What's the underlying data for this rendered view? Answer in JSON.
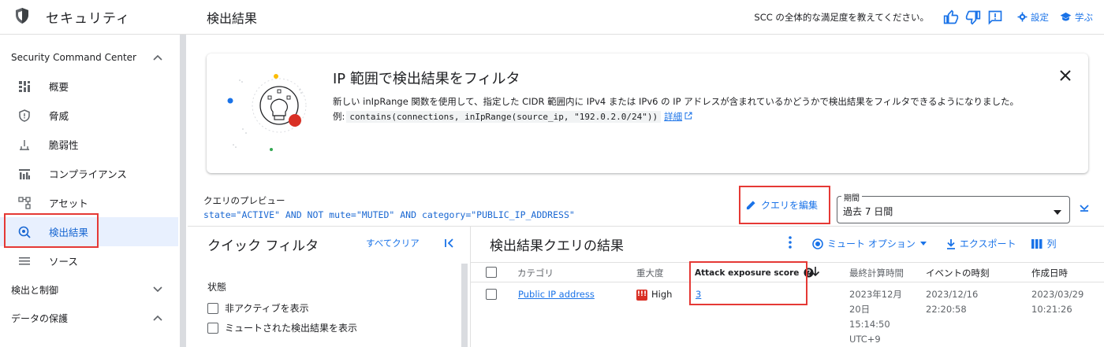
{
  "app": {
    "title": "セキュリティ"
  },
  "header": {
    "page_title": "検出結果",
    "survey_text": "SCC の全体的な満足度を教えてください。",
    "settings_label": "設定",
    "learn_label": "学ぶ"
  },
  "sidebar": {
    "section_scc": "Security Command Center",
    "items": [
      {
        "label": "概要",
        "icon": "dashboard-icon"
      },
      {
        "label": "脅威",
        "icon": "shield-icon"
      },
      {
        "label": "脆弱性",
        "icon": "vulnerability-icon"
      },
      {
        "label": "コンプライアンス",
        "icon": "compliance-icon"
      },
      {
        "label": "アセット",
        "icon": "asset-icon"
      },
      {
        "label": "検出結果",
        "icon": "findings-icon",
        "active": true
      },
      {
        "label": "ソース",
        "icon": "source-icon"
      }
    ],
    "section_detect": "検出と制御",
    "section_data": "データの保護"
  },
  "banner": {
    "title": "IP 範囲で検出結果をフィルタ",
    "description": "新しい inIpRange 関数を使用して、指定した CIDR 範囲内に IPv4 または IPv6 の IP アドレスが含まれているかどうかで検出結果をフィルタできるようになりました。",
    "example_prefix": "例:",
    "example_code": "contains(connections, inIpRange(source_ip, \"192.0.2.0/24\"))",
    "details_link": "詳細"
  },
  "query": {
    "preview_label": "クエリのプレビュー",
    "preview_text": "state=\"ACTIVE\" AND NOT mute=\"MUTED\" AND category=\"PUBLIC_IP_ADDRESS\"",
    "edit_label": "クエリを編集",
    "period_label": "期間",
    "period_value": "過去 7 日間"
  },
  "quick_filter": {
    "title": "クイック フィルタ",
    "clear_all": "すべてクリア",
    "status_label": "状態",
    "show_inactive": "非アクティブを表示",
    "show_muted": "ミュートされた検出結果を表示"
  },
  "results": {
    "title": "検出結果クエリの結果",
    "mute_options": "ミュート オプション",
    "export": "エクスポート",
    "columns_btn": "列",
    "columns": {
      "category": "カテゴリ",
      "severity": "重大度",
      "attack_score": "Attack exposure score",
      "last_scan": "最終計算時間",
      "event_time": "イベントの時刻",
      "created": "作成日時"
    },
    "rows": [
      {
        "category": "Public IP address",
        "severity": "High",
        "attack_score": "3",
        "last_scan_1": "2023年12月",
        "last_scan_2": "20日",
        "last_scan_3": "15:14:50",
        "last_scan_4": "UTC+9",
        "event_date": "2023/12/16",
        "event_time": "22:20:58",
        "created_date": "2023/03/29",
        "created_time": "10:21:26"
      }
    ]
  },
  "colors": {
    "accent": "#1a73e8",
    "highlight": "#e53935",
    "active_bg": "#e8f0fe",
    "severity_high": "#d93025"
  }
}
